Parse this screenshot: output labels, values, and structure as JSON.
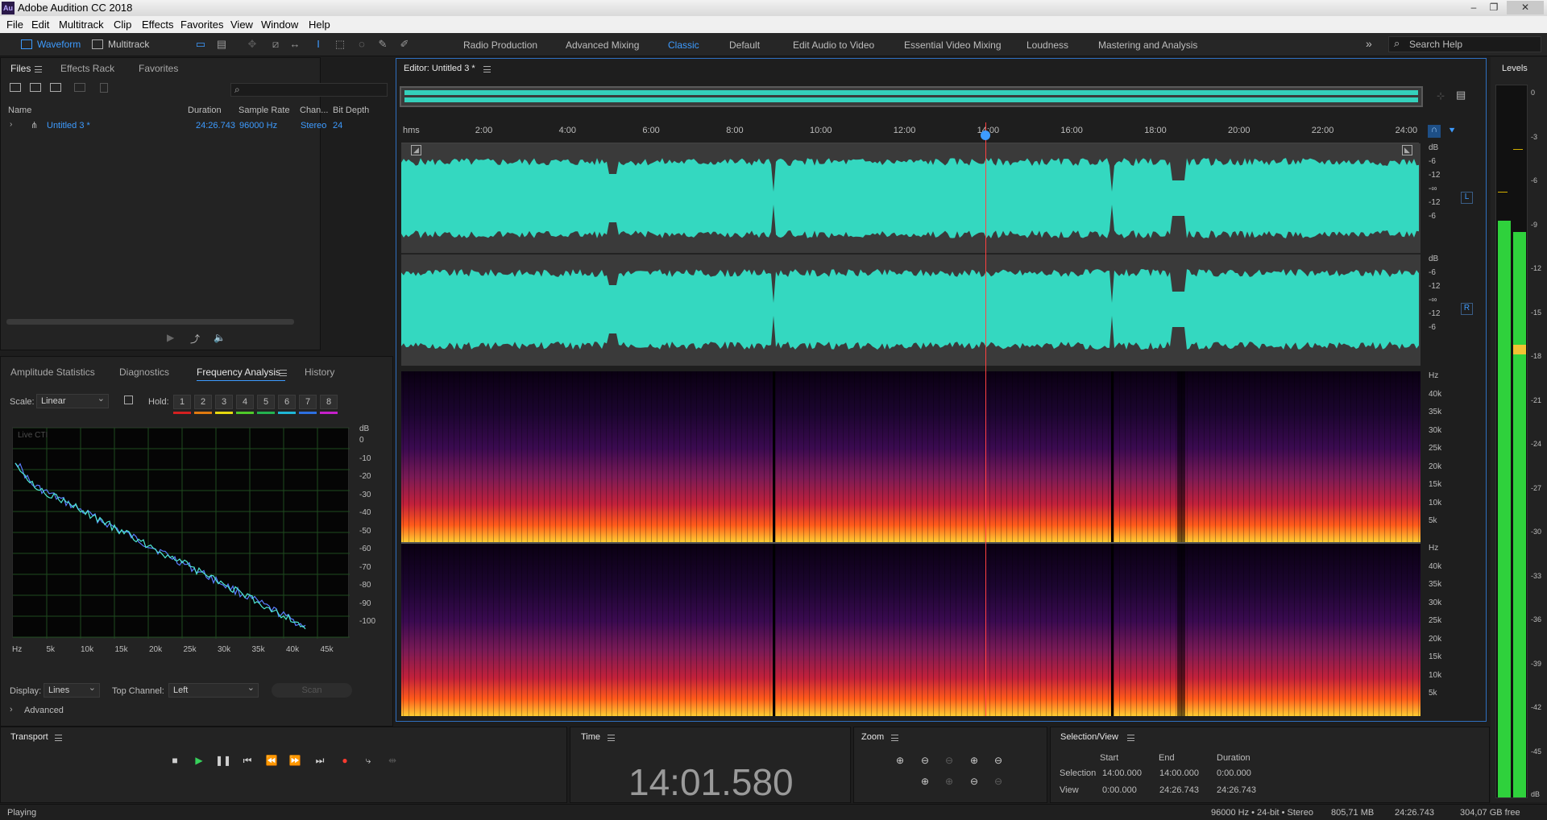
{
  "app": {
    "title": "Adobe Audition CC 2018",
    "icon": "Au"
  },
  "window_controls": [
    "–",
    "❐",
    "✕"
  ],
  "menu": [
    "File",
    "Edit",
    "Multitrack",
    "Clip",
    "Effects",
    "Favorites",
    "View",
    "Window",
    "Help"
  ],
  "toolbar": {
    "waveform": "Waveform",
    "multitrack": "Multitrack"
  },
  "workspaces": [
    "Radio Production",
    "Advanced Mixing",
    "Classic",
    "Default",
    "Edit Audio to Video",
    "Essential Video Mixing",
    "Loudness",
    "Mastering and Analysis"
  ],
  "active_workspace": "Classic",
  "search_help": "Search Help",
  "files_panel": {
    "tabs": [
      "Files",
      "Effects Rack",
      "Favorites"
    ],
    "columns": [
      "Name",
      "Duration",
      "Sample Rate",
      "Chan...",
      "Bit Depth"
    ],
    "rows": [
      {
        "name": "Untitled 3 *",
        "duration": "24:26.743",
        "sample_rate": "96000 Hz",
        "channels": "Stereo",
        "bit_depth": "24"
      }
    ]
  },
  "analysis_panel": {
    "tabs": [
      "Amplitude Statistics",
      "Diagnostics",
      "Frequency Analysis",
      "History"
    ],
    "scale_label": "Scale:",
    "scale_value": "Linear",
    "hold_label": "Hold:",
    "hold_buttons": [
      "1",
      "2",
      "3",
      "4",
      "5",
      "6",
      "7",
      "8"
    ],
    "hold_colors": [
      "#d42020",
      "#e07a10",
      "#e6d80f",
      "#4fc92a",
      "#23b24f",
      "#1fb6d6",
      "#2d6fe0",
      "#c520c9"
    ],
    "live_cti": "Live CTI",
    "db_unit": "dB",
    "db_ticks": [
      "0",
      "-10",
      "-20",
      "-30",
      "-40",
      "-50",
      "-60",
      "-70",
      "-80",
      "-90",
      "-100"
    ],
    "hz_ticks": [
      "Hz",
      "5k",
      "10k",
      "15k",
      "20k",
      "25k",
      "30k",
      "35k",
      "40k",
      "45k"
    ],
    "display_label": "Display:",
    "display_value": "Lines",
    "top_channel_label": "Top Channel:",
    "top_channel_value": "Left",
    "scan": "Scan",
    "advanced": "Advanced"
  },
  "editor": {
    "title": "Editor: Untitled 3 *",
    "ruler": [
      "hms",
      "2:00",
      "4:00",
      "6:00",
      "8:00",
      "10:00",
      "12:00",
      "14:00",
      "16:00",
      "18:00",
      "20:00",
      "22:00",
      "24:00"
    ],
    "db_labels": [
      "dB",
      "-6",
      "-12",
      "-∞",
      "-12",
      "-6"
    ],
    "channels": [
      "L",
      "R"
    ],
    "hz_labels": [
      "Hz",
      "40k",
      "35k",
      "30k",
      "25k",
      "20k",
      "15k",
      "10k",
      "5k"
    ]
  },
  "levels": {
    "title": "Levels",
    "ticks": [
      "0",
      "-3",
      "-6",
      "-9",
      "-12",
      "-15",
      "-18",
      "-21",
      "-24",
      "-27",
      "-30",
      "-33",
      "-36",
      "-39",
      "-42",
      "-45"
    ],
    "unit": "dB",
    "level_left": 0.81,
    "level_right": 0.81
  },
  "transport": {
    "title": "Transport"
  },
  "time": {
    "title": "Time",
    "value": "14:01.580"
  },
  "zoom": {
    "title": "Zoom"
  },
  "selection_view": {
    "title": "Selection/View",
    "headers": [
      "Start",
      "End",
      "Duration"
    ],
    "selection_label": "Selection",
    "selection": [
      "14:00.000",
      "14:00.000",
      "0:00.000"
    ],
    "view_label": "View",
    "view": [
      "0:00.000",
      "24:26.743",
      "24:26.743"
    ]
  },
  "status": {
    "state": "Playing",
    "format": "96000 Hz • 24-bit • Stereo",
    "size": "805,71 MB",
    "duration": "24:26.743",
    "free": "304,07 GB free"
  }
}
